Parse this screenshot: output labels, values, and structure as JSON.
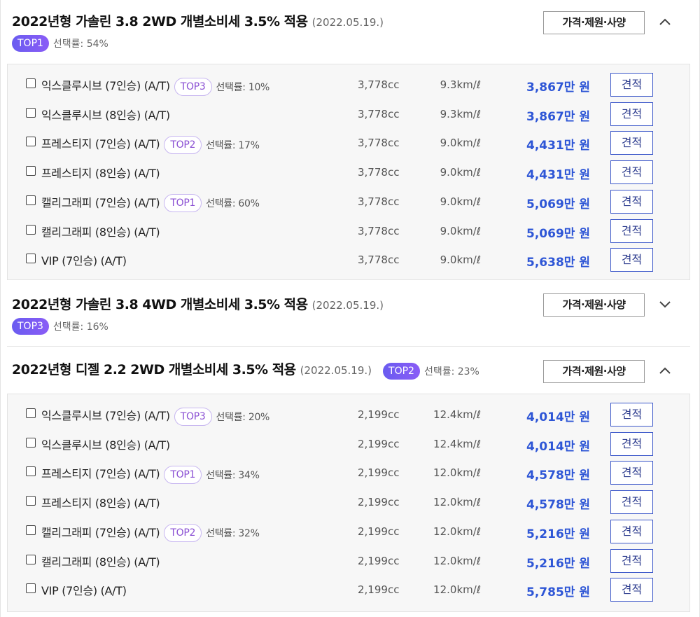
{
  "sections": [
    {
      "title": "2022년형 가솔린 3.8 2WD 개별소비세 3.5% 적용",
      "date": "(2022.05.19.)",
      "badge": "TOP1",
      "rate": "선택률: 54%",
      "spec_label": "가격·제원·사양",
      "expanded": true,
      "trims": [
        {
          "name": "익스클루시브 (7인승) (A/T)",
          "top": "TOP3",
          "rate": "선택률: 10%",
          "cc": "3,778cc",
          "eff": "9.3km/ℓ",
          "price": "3,867만 원",
          "quote": "견적"
        },
        {
          "name": "익스클루시브 (8인승) (A/T)",
          "top": "",
          "rate": "",
          "cc": "3,778cc",
          "eff": "9.3km/ℓ",
          "price": "3,867만 원",
          "quote": "견적"
        },
        {
          "name": "프레스티지 (7인승) (A/T)",
          "top": "TOP2",
          "rate": "선택률: 17%",
          "cc": "3,778cc",
          "eff": "9.0km/ℓ",
          "price": "4,431만 원",
          "quote": "견적"
        },
        {
          "name": "프레스티지 (8인승) (A/T)",
          "top": "",
          "rate": "",
          "cc": "3,778cc",
          "eff": "9.0km/ℓ",
          "price": "4,431만 원",
          "quote": "견적"
        },
        {
          "name": "캘리그래피 (7인승) (A/T)",
          "top": "TOP1",
          "rate": "선택률: 60%",
          "cc": "3,778cc",
          "eff": "9.0km/ℓ",
          "price": "5,069만 원",
          "quote": "견적"
        },
        {
          "name": "캘리그래피 (8인승) (A/T)",
          "top": "",
          "rate": "",
          "cc": "3,778cc",
          "eff": "9.0km/ℓ",
          "price": "5,069만 원",
          "quote": "견적"
        },
        {
          "name": "VIP (7인승) (A/T)",
          "top": "",
          "rate": "",
          "cc": "3,778cc",
          "eff": "9.0km/ℓ",
          "price": "5,638만 원",
          "quote": "견적"
        }
      ]
    },
    {
      "title": "2022년형 가솔린 3.8 4WD 개별소비세 3.5% 적용",
      "date": "(2022.05.19.)",
      "badge": "TOP3",
      "rate": "선택률: 16%",
      "spec_label": "가격·제원·사양",
      "expanded": false,
      "trims": []
    },
    {
      "title": "2022년형 디젤 2.2 2WD 개별소비세 3.5% 적용",
      "date": "(2022.05.19.)",
      "badge": "TOP2",
      "rate": "선택률: 23%",
      "spec_label": "가격·제원·사양",
      "expanded": true,
      "trims": [
        {
          "name": "익스클루시브 (7인승) (A/T)",
          "top": "TOP3",
          "rate": "선택률: 20%",
          "cc": "2,199cc",
          "eff": "12.4km/ℓ",
          "price": "4,014만 원",
          "quote": "견적"
        },
        {
          "name": "익스클루시브 (8인승) (A/T)",
          "top": "",
          "rate": "",
          "cc": "2,199cc",
          "eff": "12.4km/ℓ",
          "price": "4,014만 원",
          "quote": "견적"
        },
        {
          "name": "프레스티지 (7인승) (A/T)",
          "top": "TOP1",
          "rate": "선택률: 34%",
          "cc": "2,199cc",
          "eff": "12.0km/ℓ",
          "price": "4,578만 원",
          "quote": "견적"
        },
        {
          "name": "프레스티지 (8인승) (A/T)",
          "top": "",
          "rate": "",
          "cc": "2,199cc",
          "eff": "12.0km/ℓ",
          "price": "4,578만 원",
          "quote": "견적"
        },
        {
          "name": "캘리그래피 (7인승) (A/T)",
          "top": "TOP2",
          "rate": "선택률: 32%",
          "cc": "2,199cc",
          "eff": "12.0km/ℓ",
          "price": "5,216만 원",
          "quote": "견적"
        },
        {
          "name": "캘리그래피 (8인승) (A/T)",
          "top": "",
          "rate": "",
          "cc": "2,199cc",
          "eff": "12.0km/ℓ",
          "price": "5,216만 원",
          "quote": "견적"
        },
        {
          "name": "VIP (7인승) (A/T)",
          "top": "",
          "rate": "",
          "cc": "2,199cc",
          "eff": "12.0km/ℓ",
          "price": "5,785만 원",
          "quote": "견적"
        }
      ]
    }
  ],
  "colors": {
    "price": "#2e56d6",
    "badge": "#7a5cf3",
    "chip_text": "#8a4fd3"
  }
}
